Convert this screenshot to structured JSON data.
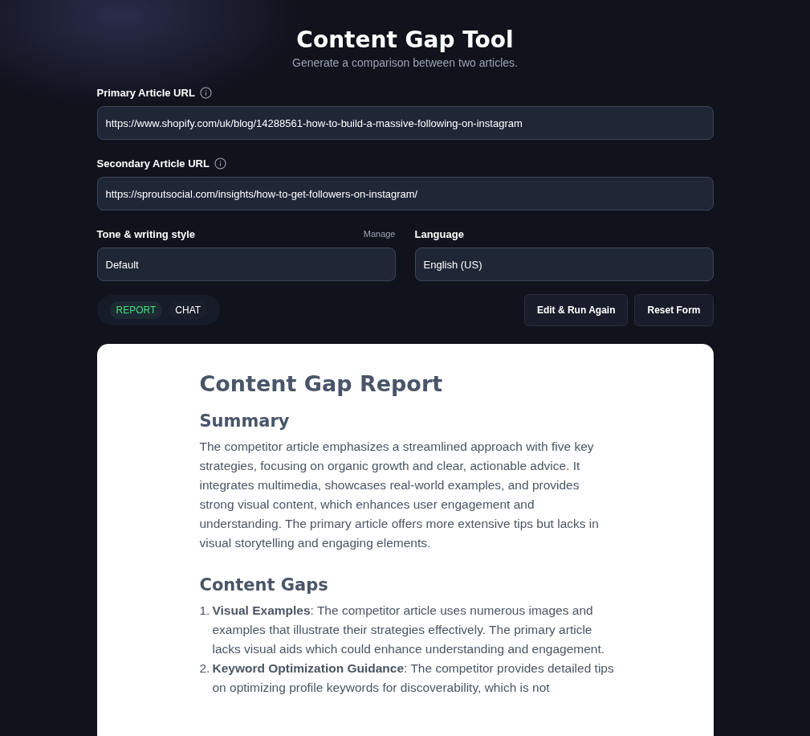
{
  "header": {
    "title": "Content Gap Tool",
    "subtitle": "Generate a comparison between two articles."
  },
  "fields": [
    {
      "label": "Primary Article URL",
      "value": "https://www.shopify.com/uk/blog/14288561-how-to-build-a-massive-following-on-instagram"
    },
    {
      "label": "Secondary Article URL",
      "value": "https://sproutsocial.com/insights/how-to-get-followers-on-instagram/"
    }
  ],
  "selects": [
    {
      "label": "Tone & writing style",
      "action": "Manage",
      "value": "Default"
    },
    {
      "label": "Language",
      "value": "English (US)"
    }
  ],
  "view_tabs": [
    {
      "label": "REPORT",
      "selected": true
    },
    {
      "label": "CHAT",
      "selected": false
    }
  ],
  "buttons": [
    "Edit & Run Again",
    "Reset Form"
  ],
  "report": {
    "title": "Content Gap Report",
    "sections": [
      {
        "heading": "Summary",
        "paragraph": "The competitor article emphasizes a streamlined approach with five key strategies, focusing on organic growth and clear, actionable advice. It integrates multimedia, showcases real-world examples, and provides strong visual content, which enhances user engagement and understanding. The primary article offers more extensive tips but lacks in visual storytelling and engaging elements."
      },
      {
        "heading": "Content Gaps",
        "items": [
          {
            "number": "1.",
            "text": "**Visual Examples**: The competitor article uses numerous images and examples that illustrate their strategies effectively. The primary article lacks visual aids which could enhance understanding and engagement."
          },
          {
            "number": "2.",
            "text": "**Keyword Optimization Guidance**: The competitor provides detailed tips on optimizing profile keywords for discoverability, which is not"
          }
        ]
      }
    ]
  }
}
